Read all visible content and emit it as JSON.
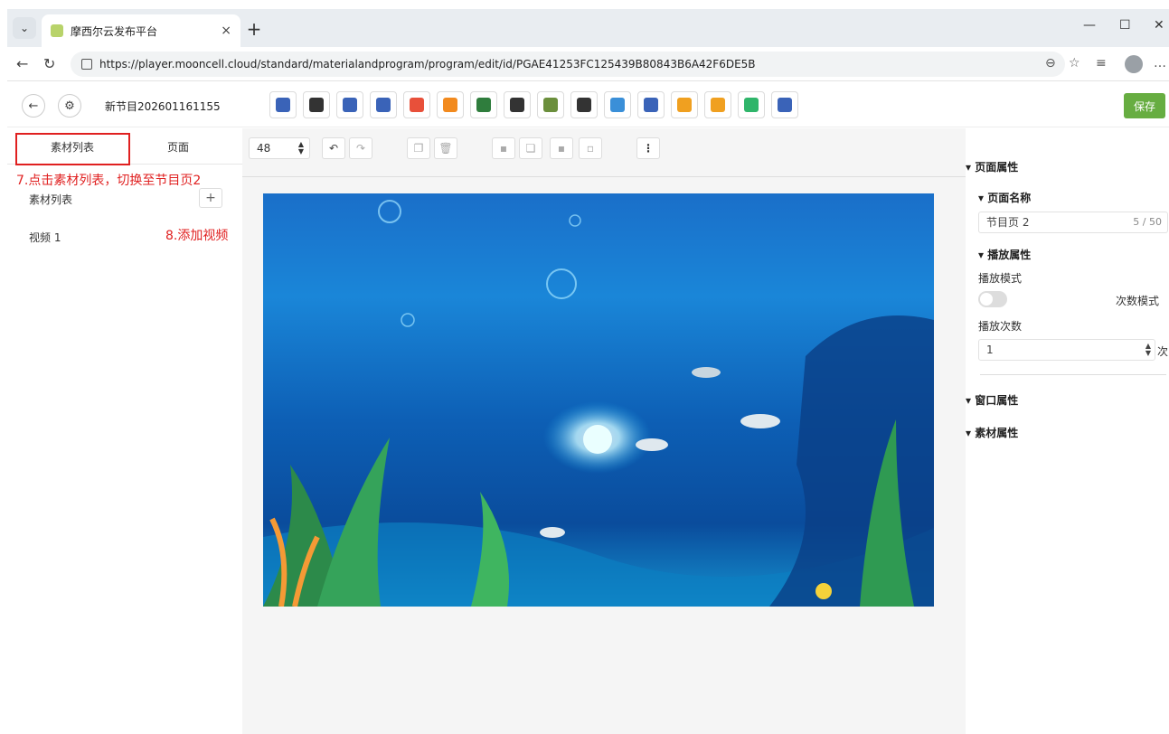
{
  "browser": {
    "tab_title": "摩西尔云发布平台",
    "tab_close": "×",
    "new_tab": "+",
    "url": "https://player.mooncell.cloud/standard/materialandprogram/program/edit/id/PGAE41253FC125439B80843B6A42F6DE5B"
  },
  "header": {
    "program_name": "新节目202601161155",
    "save_label": "保存",
    "tools": [
      {
        "icon": "window-icon",
        "color": "#3a63b8"
      },
      {
        "icon": "copy-pages-icon",
        "color": "#333333"
      },
      {
        "icon": "layers-icon",
        "color": "#3a63b8"
      },
      {
        "icon": "video-icon",
        "color": "#3a63b8"
      },
      {
        "icon": "image-icon",
        "color": "#e8503a"
      },
      {
        "icon": "folder-icon",
        "color": "#f28a1e"
      },
      {
        "icon": "text-icon",
        "color": "#2f7d3d"
      },
      {
        "icon": "scroll-text-icon",
        "color": "#333333"
      },
      {
        "icon": "table-icon",
        "color": "#6b8f3c"
      },
      {
        "icon": "clock-icon",
        "color": "#333333"
      },
      {
        "icon": "weather-icon",
        "color": "#3a8fd8"
      },
      {
        "icon": "calculator-icon",
        "color": "#3a63b8"
      },
      {
        "icon": "marquee-icon",
        "color": "#f0a020"
      },
      {
        "icon": "hourglass-icon",
        "color": "#f0a020"
      },
      {
        "icon": "folder-green-icon",
        "color": "#2fb56a"
      },
      {
        "icon": "device-icon",
        "color": "#3a63b8"
      }
    ]
  },
  "left_panel": {
    "tab_materials": "素材列表",
    "tab_pages": "页面",
    "annotation_switch": "7.点击素材列表，切换至节目页2",
    "materials_header": "素材列表",
    "add_symbol": "+",
    "annotation_add": "8.添加视频",
    "items": [
      "视频 1"
    ]
  },
  "canvas": {
    "zoom_value": "48",
    "more_symbol": "⋮"
  },
  "right_panel": {
    "page_props": "▾ 页面属性",
    "page_name_label": "▾ 页面名称",
    "page_name_value": "节目页 2",
    "page_name_count": "5 / 50",
    "play_props": "▾ 播放属性",
    "play_mode_label": "播放模式",
    "play_mode_option": "次数模式",
    "play_count_label": "播放次数",
    "play_count_value": "1",
    "play_count_unit": "次",
    "window_props": "▾ 窗口属性",
    "material_props": "▾ 素材属性"
  }
}
